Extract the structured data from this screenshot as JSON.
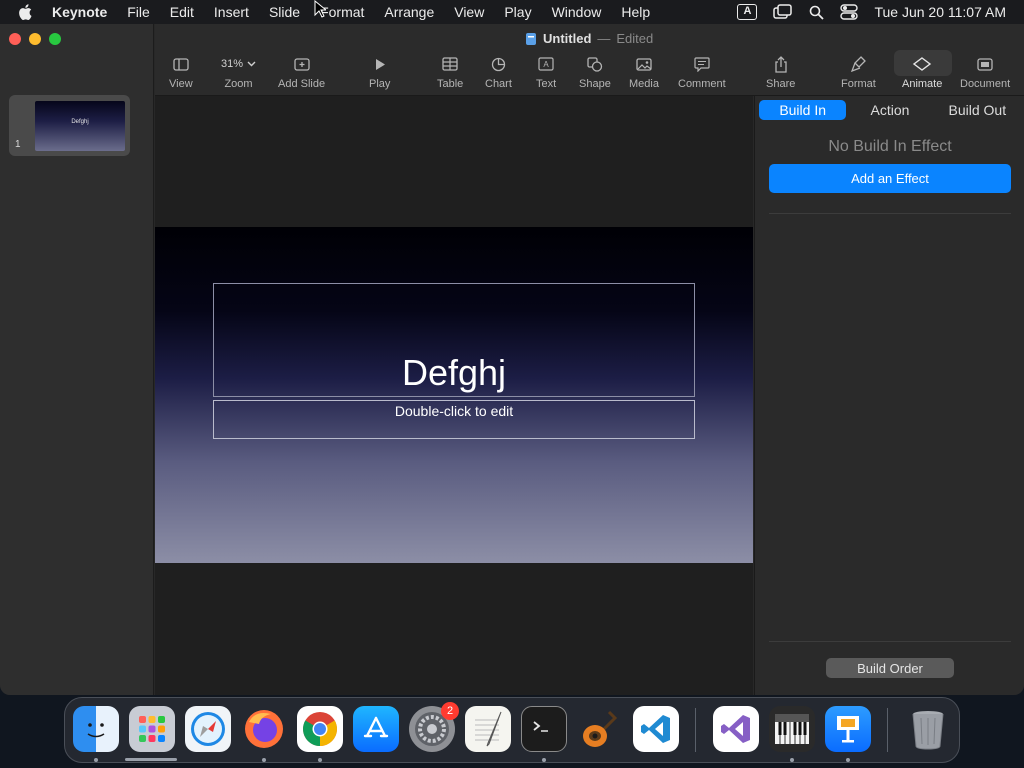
{
  "menubar": {
    "app_name": "Keynote",
    "items": [
      "File",
      "Edit",
      "Insert",
      "Slide",
      "Format",
      "Arrange",
      "View",
      "Play",
      "Window",
      "Help"
    ],
    "keyboard_indicator": "A",
    "clock": "Tue Jun 20  11:07 AM"
  },
  "document": {
    "title": "Untitled",
    "separator": "—",
    "status": "Edited"
  },
  "toolbar": {
    "view": "View",
    "zoom_value": "31%",
    "zoom": "Zoom",
    "add_slide": "Add Slide",
    "play": "Play",
    "table": "Table",
    "chart": "Chart",
    "text": "Text",
    "shape": "Shape",
    "media": "Media",
    "comment": "Comment",
    "share": "Share",
    "format": "Format",
    "animate": "Animate",
    "document": "Document"
  },
  "navigator": {
    "slides": [
      {
        "number": "1",
        "title": "Defghj"
      }
    ]
  },
  "slide": {
    "title": "Defghj",
    "subtitle_placeholder": "Double-click to edit"
  },
  "inspector": {
    "tabs": [
      "Build In",
      "Action",
      "Build Out"
    ],
    "active_tab": "Build In",
    "empty_message": "No Build In Effect",
    "add_effect": "Add an Effect",
    "build_order": "Build Order"
  },
  "dock": {
    "settings_badge": "2",
    "apps": [
      "finder",
      "launchpad",
      "safari",
      "firefox",
      "chrome",
      "app-store",
      "system-settings",
      "textedit",
      "terminal",
      "garageband",
      "vscode",
      "visual-studio",
      "piano",
      "keynote",
      "trash"
    ]
  },
  "colors": {
    "accent": "#0a84ff",
    "slide_top": "#000005",
    "slide_bottom": "#8c8ea6"
  }
}
